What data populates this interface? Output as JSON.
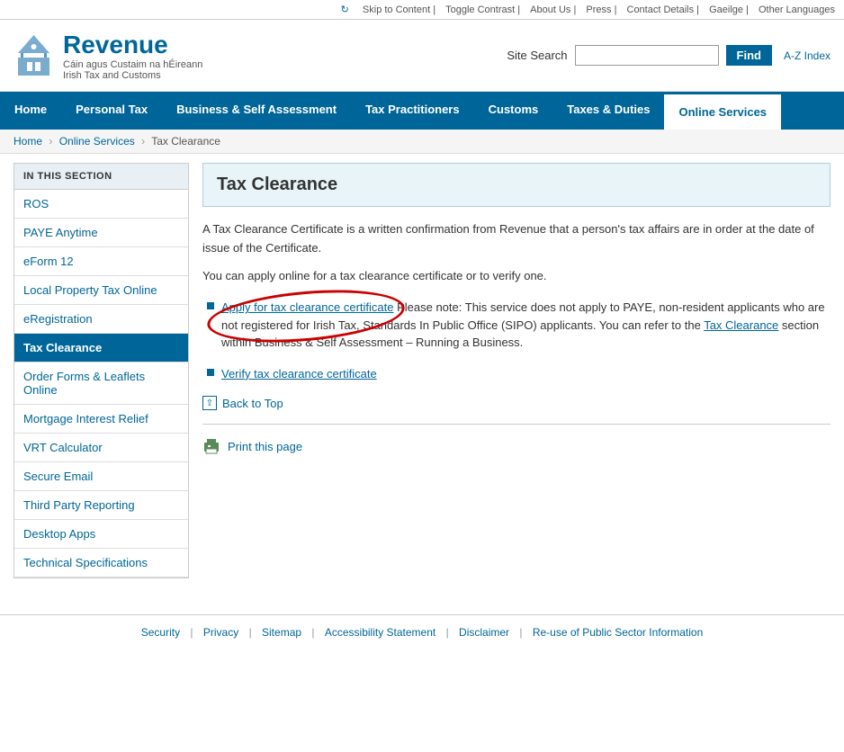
{
  "utility": {
    "skip": "Skip to Content",
    "toggle_contrast": "Toggle Contrast",
    "about_us": "About Us",
    "press": "Press",
    "contact_details": "Contact Details",
    "gaeilge": "Gaeilge",
    "other_languages": "Other Languages"
  },
  "header": {
    "logo_line1": "Revenue",
    "logo_line2": "Cáin agus Custaim na hÉireann",
    "logo_line3": "Irish Tax and Customs",
    "search_label": "Site Search",
    "search_placeholder": "",
    "find_btn": "Find",
    "az_index": "A-Z Index"
  },
  "nav": {
    "items": [
      {
        "label": "Home",
        "active": false
      },
      {
        "label": "Personal Tax",
        "active": false
      },
      {
        "label": "Business & Self Assessment",
        "active": false
      },
      {
        "label": "Tax Practitioners",
        "active": false
      },
      {
        "label": "Customs",
        "active": false
      },
      {
        "label": "Taxes & Duties",
        "active": false
      },
      {
        "label": "Online Services",
        "active": true
      }
    ]
  },
  "breadcrumb": {
    "home": "Home",
    "online_services": "Online Services",
    "current": "Tax Clearance"
  },
  "sidebar": {
    "section_label": "IN THIS SECTION",
    "items": [
      {
        "label": "ROS",
        "active": false
      },
      {
        "label": "PAYE Anytime",
        "active": false
      },
      {
        "label": "eForm 12",
        "active": false
      },
      {
        "label": "Local Property Tax Online",
        "active": false
      },
      {
        "label": "eRegistration",
        "active": false
      },
      {
        "label": "Tax Clearance",
        "active": true
      },
      {
        "label": "Order Forms & Leaflets Online",
        "active": false
      },
      {
        "label": "Mortgage Interest Relief",
        "active": false
      },
      {
        "label": "VRT Calculator",
        "active": false
      },
      {
        "label": "Secure Email",
        "active": false
      },
      {
        "label": "Third Party Reporting",
        "active": false
      },
      {
        "label": "Desktop Apps",
        "active": false
      },
      {
        "label": "Technical Specifications",
        "active": false
      }
    ]
  },
  "main": {
    "page_title": "Tax Clearance",
    "intro1": "A Tax Clearance Certificate is a written confirmation from Revenue that a person's tax affairs are in order at the date of issue of the Certificate.",
    "intro2": "You can apply online for a tax clearance certificate or to verify one.",
    "apply_link": "Apply for tax clearance certificate",
    "apply_note": " Please note: This service does not apply to PAYE, non-resident applicants who are not registered for Irish Tax, Standards In Public Office (SIPO) applicants. You can refer to the ",
    "tax_clearance_link": "Tax Clearance",
    "apply_note2": " section within Business & Self Assessment – Running a Business.",
    "verify_link": "Verify tax clearance certificate",
    "back_to_top": "Back to Top",
    "print_page": "Print this page"
  },
  "footer": {
    "items": [
      "Security",
      "Privacy",
      "Sitemap",
      "Accessibility Statement",
      "Disclaimer",
      "Re-use of Public Sector Information"
    ]
  }
}
